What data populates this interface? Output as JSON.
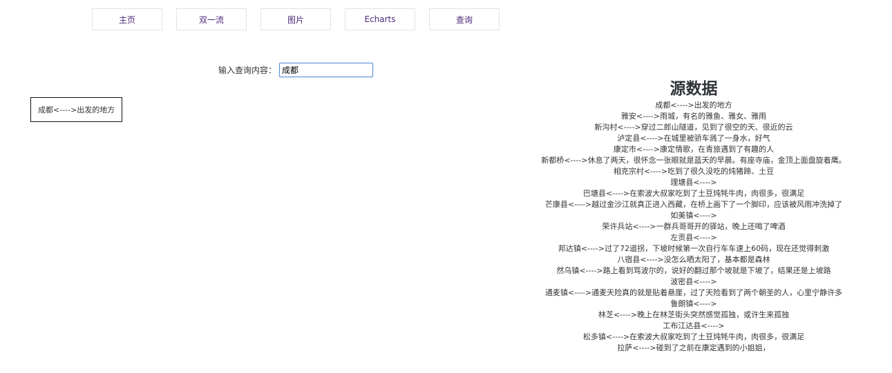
{
  "nav": {
    "items": [
      {
        "label": "主页"
      },
      {
        "label": "双一流"
      },
      {
        "label": "图片"
      },
      {
        "label": "Echarts"
      },
      {
        "label": "查询"
      }
    ]
  },
  "search": {
    "label": "输入查询内容：",
    "value": "成都"
  },
  "result": {
    "text": "成都<---->出发的地方"
  },
  "source": {
    "title": "源数据",
    "items": [
      "成都<---->出发的地方",
      "雅安<---->雨城，有名的雅鱼、雅女、雅雨",
      "新沟村<---->穿过二郎山隧道，见到了很空的天、很近的云",
      "泸定县<---->在城里被骄车溅了一身水，好气",
      "康定市<---->康定情歌，在青旅遇到了有趣的人",
      "新都桥<---->休息了两天，很怀念一张眼就是蓝天的早晨。有座寺庙，金顶上面盘旋着鹰。",
      "相克宗村<---->吃到了很久没吃的炖猪蹄、土豆",
      "理塘县<---->",
      "巴塘县<---->在索波大叔家吃到了土豆炖牦牛肉，肉很多，很满足",
      "芒康县<---->越过金沙江就真正进入西藏，在桥上画下了一个脚印，应该被风雨冲洗掉了",
      "如美镇<---->",
      "荣许兵站<---->一群兵哥哥开的驿站，晚上还喝了啤酒",
      "左贡县<---->",
      "邦达镇<---->过了72道拐，下坡时候第一次自行车车速上60码，现在还觉得刺激",
      "八宿县<---->没怎么晒太阳了，基本都是森林",
      "然乌镇<---->路上看到骂波尔的，说好的翻过那个坡就是下坡了，结果还是上坡路",
      "波密县<---->",
      "通麦镇<---->通麦天险真的就是贴着悬崖，过了天险看到了两个朝圣的人，心里宁静许多",
      "鲁朗镇<---->",
      "林芝<---->晚上在林芝街头突然感觉孤独，或许生来孤独",
      "工布江达县<---->",
      "松多镇<---->在索波大叔家吃到了土豆炖牦牛肉，肉很多，很满足",
      "拉萨<---->碰到了之前在康定遇到的小姐姐，"
    ]
  }
}
